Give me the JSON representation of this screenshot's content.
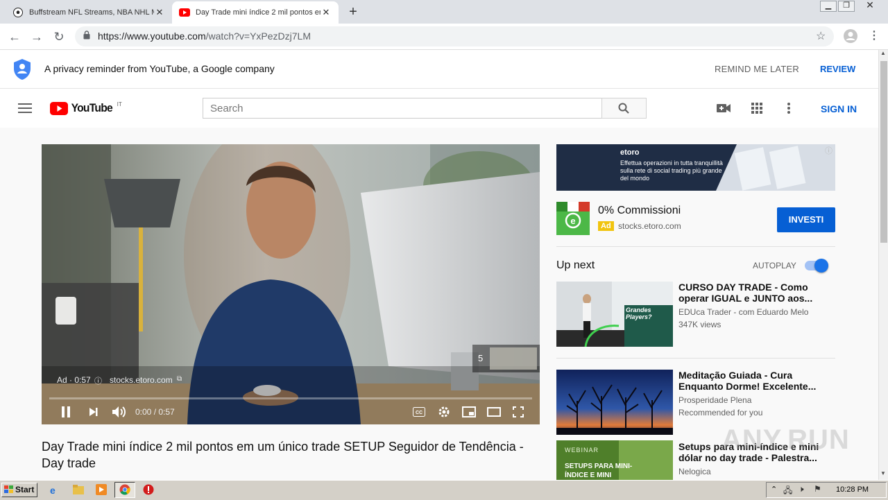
{
  "browser": {
    "tabs": [
      {
        "title": "Buffstream NFL Streams, NBA NHL M",
        "active": false
      },
      {
        "title": "Day Trade mini índice 2 mil pontos en",
        "active": true
      }
    ],
    "url_host": "https://www.youtube.com",
    "url_path": "/watch?v=YxPezDzj7LM"
  },
  "privacy": {
    "text": "A privacy reminder from YouTube, a Google company",
    "remind_label": "REMIND ME LATER",
    "review_label": "REVIEW"
  },
  "masthead": {
    "logo_text": "YouTube",
    "country_code": "IT",
    "search_placeholder": "Search",
    "signin_label": "SIGN IN"
  },
  "player": {
    "ad_label": "Ad · 0:57",
    "ad_domain": "stocks.etoro.com",
    "skip_countdown": "5",
    "time": "0:00 / 0:57",
    "progress": 0.0
  },
  "video": {
    "title": "Day Trade mini índice 2 mil pontos em um único trade SETUP Seguidor de Tendência - Day trade"
  },
  "ad": {
    "banner_brand": "etoro",
    "banner_text": "Effettua operazioni in tutta tranquillità sulla rete di social trading più grande del mondo",
    "headline": "0% Commissioni",
    "badge": "Ad",
    "domain": "stocks.etoro.com",
    "cta": "INVESTI"
  },
  "upnext": {
    "label": "Up next",
    "autoplay_label": "AUTOPLAY",
    "autoplay_on": true
  },
  "recommendations": [
    {
      "title": "CURSO DAY TRADE - Como operar IGUAL e JUNTO aos...",
      "channel": "EDUca Trader - com Eduardo Melo",
      "meta": "347K views",
      "thumb_text": "Grandes Players?"
    },
    {
      "title": "Meditação Guiada - Cura Enquanto Dorme! Excelente...",
      "channel": "Prosperidade Plena",
      "meta": "Recommended for you",
      "thumb_text": ""
    },
    {
      "title": "Setups para mini-índice e mini dólar no day trade - Palestra...",
      "channel": "Nelogica",
      "meta": "",
      "thumb_text": "SETUPS PARA MINI-ÍNDICE E MINI",
      "thumb_tag": "WEBINAR"
    }
  ],
  "watermark": "ANY.RUN",
  "taskbar": {
    "start_label": "Start",
    "clock": "10:28 PM"
  },
  "colors": {
    "youtube_red": "#ff0000",
    "link_blue": "#065fd4",
    "cta_blue": "#065fd4",
    "autoplay_blue": "#1a73e8"
  }
}
